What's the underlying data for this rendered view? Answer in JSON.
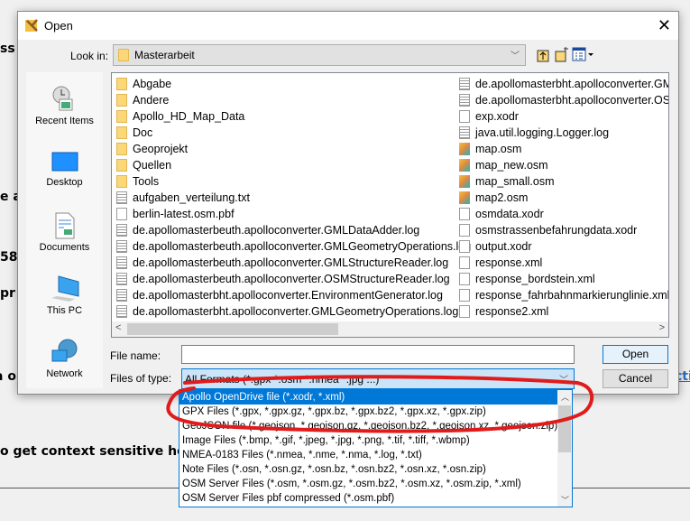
{
  "background": {
    "fragments": [
      "ss",
      "e a",
      "58",
      "pr",
      "a o",
      "o get context sensitive help."
    ],
    "link_fragment": "cti"
  },
  "dialog": {
    "title": "Open",
    "look_in_label": "Look in:",
    "look_in_value": "Masterarbeit",
    "toolbar_icons": [
      "up-folder-icon",
      "new-folder-icon",
      "view-menu-icon"
    ],
    "sidebar": [
      {
        "label": "Recent Items",
        "icon": "recent-items-icon"
      },
      {
        "label": "Desktop",
        "icon": "desktop-icon"
      },
      {
        "label": "Documents",
        "icon": "documents-icon"
      },
      {
        "label": "This PC",
        "icon": "this-pc-icon"
      },
      {
        "label": "Network",
        "icon": "network-icon"
      }
    ],
    "files_col1": [
      {
        "name": "Abgabe",
        "type": "folder"
      },
      {
        "name": "Andere",
        "type": "folder"
      },
      {
        "name": "Apollo_HD_Map_Data",
        "type": "folder"
      },
      {
        "name": "Doc",
        "type": "folder"
      },
      {
        "name": "Geoprojekt",
        "type": "folder"
      },
      {
        "name": "Quellen",
        "type": "folder"
      },
      {
        "name": "Tools",
        "type": "folder"
      },
      {
        "name": "aufgaben_verteilung.txt",
        "type": "text"
      },
      {
        "name": "berlin-latest.osm.pbf",
        "type": "file"
      },
      {
        "name": "de.apollomasterbeuth.apolloconverter.GMLDataAdder.log",
        "type": "text"
      },
      {
        "name": "de.apollomasterbeuth.apolloconverter.GMLGeometryOperations.log",
        "type": "text"
      },
      {
        "name": "de.apollomasterbeuth.apolloconverter.GMLStructureReader.log",
        "type": "text"
      },
      {
        "name": "de.apollomasterbeuth.apolloconverter.OSMStructureReader.log",
        "type": "text"
      },
      {
        "name": "de.apollomasterbht.apolloconverter.EnvironmentGenerator.log",
        "type": "text"
      },
      {
        "name": "de.apollomasterbht.apolloconverter.GMLGeometryOperations.log",
        "type": "text"
      }
    ],
    "files_col2": [
      {
        "name": "de.apollomasterbht.apolloconverter.GMLDataAdder.log",
        "type": "text"
      },
      {
        "name": "de.apollomasterbht.apolloconverter.OSMStructureReader.log",
        "type": "text"
      },
      {
        "name": "exp.xodr",
        "type": "file"
      },
      {
        "name": "java.util.logging.Logger.log",
        "type": "text"
      },
      {
        "name": "map.osm",
        "type": "map"
      },
      {
        "name": "map_new.osm",
        "type": "map"
      },
      {
        "name": "map_small.osm",
        "type": "map"
      },
      {
        "name": "map2.osm",
        "type": "map"
      },
      {
        "name": "osmdata.xodr",
        "type": "file"
      },
      {
        "name": "osmstrassenbefahrungdata.xodr",
        "type": "file"
      },
      {
        "name": "output.xodr",
        "type": "file"
      },
      {
        "name": "response.xml",
        "type": "file"
      },
      {
        "name": "response_bordstein.xml",
        "type": "file"
      },
      {
        "name": "response_fahrbahnmarkierunglinie.xml",
        "type": "file"
      },
      {
        "name": "response2.xml",
        "type": "file"
      }
    ],
    "file_name_label": "File name:",
    "file_name_value": "",
    "files_of_type_label": "Files of type:",
    "files_of_type_value": "All Formats (*.gpx *.osm *.nmea *.jpg ...)",
    "open_label": "Open",
    "cancel_label": "Cancel",
    "type_options": [
      "Apollo OpenDrive file (*.xodr, *.xml)",
      "GPX Files (*.gpx, *.gpx.gz, *.gpx.bz, *.gpx.bz2, *.gpx.xz, *.gpx.zip)",
      "GeoJSON file (*.geojson, *.geojson.gz, *.geojson.bz2, *.geojson.xz, *.geojson.zip)",
      "Image Files (*.bmp, *.gif, *.jpeg, *.jpg, *.png, *.tif, *.tiff, *.wbmp)",
      "NMEA-0183 Files (*.nmea, *.nme, *.nma, *.log, *.txt)",
      "Note Files (*.osn, *.osn.gz, *.osn.bz, *.osn.bz2, *.osn.xz, *.osn.zip)",
      "OSM Server Files (*.osm, *.osm.gz, *.osm.bz2, *.osm.xz, *.osm.zip, *.xml)",
      "OSM Server Files pbf compressed (*.osm.pbf)"
    ],
    "selected_option_index": 0,
    "annotation_color": "#e01b1b"
  }
}
